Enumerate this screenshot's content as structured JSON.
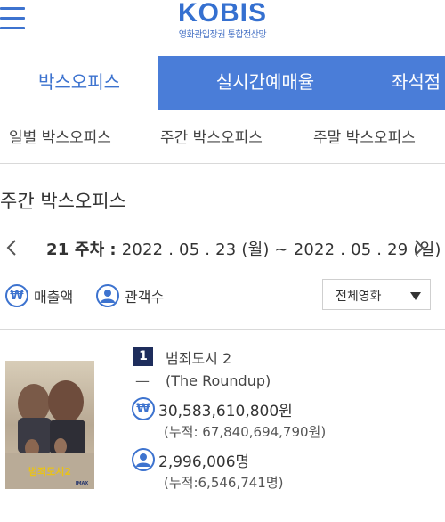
{
  "header": {
    "logo_text": "KOBIS",
    "logo_subtitle": "영화관입장권 통합전산망",
    "menu_icon": "hamburger-menu-icon"
  },
  "tabs": [
    {
      "label": "박스오피스",
      "active": true
    },
    {
      "label": "실시간예매율",
      "active": false
    },
    {
      "label": "좌석점",
      "active": false
    }
  ],
  "subtabs": [
    {
      "label": "일별 박스오피스"
    },
    {
      "label": "주간 박스오피스"
    },
    {
      "label": "주말 박스오피스"
    }
  ],
  "section_title": "주간 박스오피스",
  "period": {
    "week": "21 주차",
    "separator": ":",
    "start": "2022 . 05 . 23 (월)",
    "tilde": "~",
    "end": "2022 . 05 . 29 (일)",
    "prev_icon": "chevron-left-icon",
    "next_icon": "chevron-right-icon"
  },
  "sort_options": [
    {
      "label": "매출액",
      "icon": "won-icon",
      "glyph": "₩"
    },
    {
      "label": "관객수",
      "icon": "person-icon"
    }
  ],
  "filter": {
    "selected": "전체영화",
    "icon": "caret-down-icon"
  },
  "movies": [
    {
      "rank": "1",
      "title": "범죄도시 2",
      "change": "—",
      "original_title": "(The Roundup)",
      "sales": "30,583,610,800원",
      "sales_accumulated": "(누적: 67,840,694,790원)",
      "audience": "2,996,006명",
      "audience_accumulated": "(누적:6,546,741명)",
      "poster_title": "범죄도시2",
      "poster_badge": "IMAX"
    }
  ],
  "colors": {
    "accent": "#3d73cf",
    "tab_active_bg": "#4a7dd8",
    "rank_bg": "#1e2d5c"
  }
}
